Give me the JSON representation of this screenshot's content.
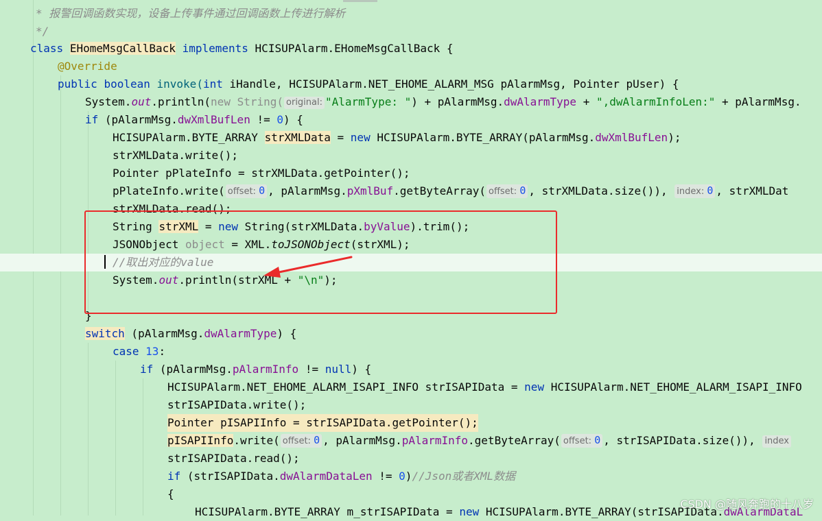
{
  "editor": {
    "lines": [
      {
        "id": "l1",
        "text": "* 报警回调函数实现，设备上传事件通过回调函数上传进行解析"
      },
      {
        "id": "l2",
        "text": "*/"
      },
      {
        "id": "l3",
        "kw": "class",
        "cls": "EHomeMsgCallBack",
        "impl": "implements",
        "iface": "HCISUPAlarm.EHomeMsgCallBack {"
      },
      {
        "id": "l4",
        "text": "@Override"
      },
      {
        "id": "l5",
        "a": "public",
        "b": "boolean",
        "c": "invoke(",
        "d": "int",
        "e": " iHandle, HCISUPAlarm.NET_EHOME_ALARM_MSG pAlarmMsg, Pointer pUser) {"
      },
      {
        "id": "l6",
        "a": "System.",
        "b": "out",
        "c": ".println(",
        "d": "new String(",
        "hint": "original:",
        "s1": "\"AlarmType: \"",
        "e": ") + pAlarmMsg.",
        "f": "dwAlarmType",
        "g": " + ",
        "s2": "\",dwAlarmInfoLen:\"",
        "h": " + pAlarmMsg."
      },
      {
        "id": "l7",
        "a": "if",
        "b": " (pAlarmMsg.",
        "c": "dwXmlBufLen",
        "d": " != ",
        "n": "0",
        "e": ") {"
      },
      {
        "id": "l8",
        "a": "HCISUPAlarm.BYTE_ARRAY ",
        "b": "strXMLData",
        "c": " = ",
        "d": "new",
        "e": " HCISUPAlarm.BYTE_ARRAY(pAlarmMsg.",
        "f": "dwXmlBufLen",
        "g": ");"
      },
      {
        "id": "l9",
        "text": "strXMLData.write();"
      },
      {
        "id": "l10",
        "text": "Pointer pPlateInfo = strXMLData.getPointer();"
      },
      {
        "id": "l11",
        "a": "pPlateInfo.write(",
        "h1": "offset:",
        "n1": "0",
        "b": ", pAlarmMsg.",
        "c": "pXmlBuf",
        "d": ".getByteArray(",
        "h2": "offset:",
        "n2": "0",
        "e": ", strXMLData.size()),",
        "h3": "index:",
        "n3": "0",
        "f": ", strXMLDat"
      },
      {
        "id": "l12",
        "text": "strXMLData.read();"
      },
      {
        "id": "l13",
        "a": "String ",
        "b": "strXML",
        "c": " = ",
        "d": "new",
        "e": " String(strXMLData.",
        "f": "byValue",
        "g": ").trim();"
      },
      {
        "id": "l14",
        "a": "JSONObject ",
        "b": "object",
        "c": " = XML.",
        "d": "toJSONObject",
        "e": "(strXML);"
      },
      {
        "id": "l15",
        "text": "//取出对应的value"
      },
      {
        "id": "l16",
        "a": "System.",
        "b": "out",
        "c": ".println(strXML + ",
        "s": "\"\\n\"",
        "d": ");"
      },
      {
        "id": "l17",
        "text": "}"
      },
      {
        "id": "l18",
        "a": "switch",
        "b": " (pAlarmMsg.",
        "c": "dwAlarmType",
        "d": ") {"
      },
      {
        "id": "l19",
        "a": "case",
        "n": " 13",
        ":": ":"
      },
      {
        "id": "l20",
        "a": "if",
        "b": " (pAlarmMsg.",
        "c": "pAlarmInfo",
        "d": " != ",
        "e": "null",
        "f": ") {"
      },
      {
        "id": "l21",
        "a": "HCISUPAlarm.NET_EHOME_ALARM_ISAPI_INFO strISAPIData = ",
        "b": "new",
        "c": " HCISUPAlarm.NET_EHOME_ALARM_ISAPI_INFO"
      },
      {
        "id": "l22",
        "text": "strISAPIData.write();"
      },
      {
        "id": "l23",
        "text": "Pointer pISAPIInfo = strISAPIData.getPointer();"
      },
      {
        "id": "l24",
        "a": "pISAPIInfo",
        "b": ".write(",
        "h1": "offset:",
        "n1": "0",
        "c": ", pAlarmMsg.",
        "d": "pAlarmInfo",
        "e": ".getByteArray(",
        "h2": "offset:",
        "n2": "0",
        "f": ", strISAPIData.size()),",
        "h3": "index"
      },
      {
        "id": "l25",
        "text": "strISAPIData.read();"
      },
      {
        "id": "l26",
        "a": "if",
        "b": " (strISAPIData.",
        "c": "dwAlarmDataLen",
        "d": " != ",
        "n": "0",
        "e": ")",
        "cm": "//Json或者XML数据"
      },
      {
        "id": "l27",
        "text": "{"
      },
      {
        "id": "l28",
        "a": "HCISUPAlarm.BYTE_ARRAY m_strISAPIData = ",
        "b": "new",
        "c": " HCISUPAlarm.BYTE_ARRAY(strISAPIData.",
        "d": "dwAlarmDataL"
      }
    ]
  },
  "watermark": "CSDN @随风奔跑的十八岁",
  "colors": {
    "background": "#c7edcc",
    "keyword": "#0033b3",
    "string": "#067d17",
    "number": "#1750eb",
    "field": "#871094",
    "annotation_box": "#ea2b2b"
  }
}
